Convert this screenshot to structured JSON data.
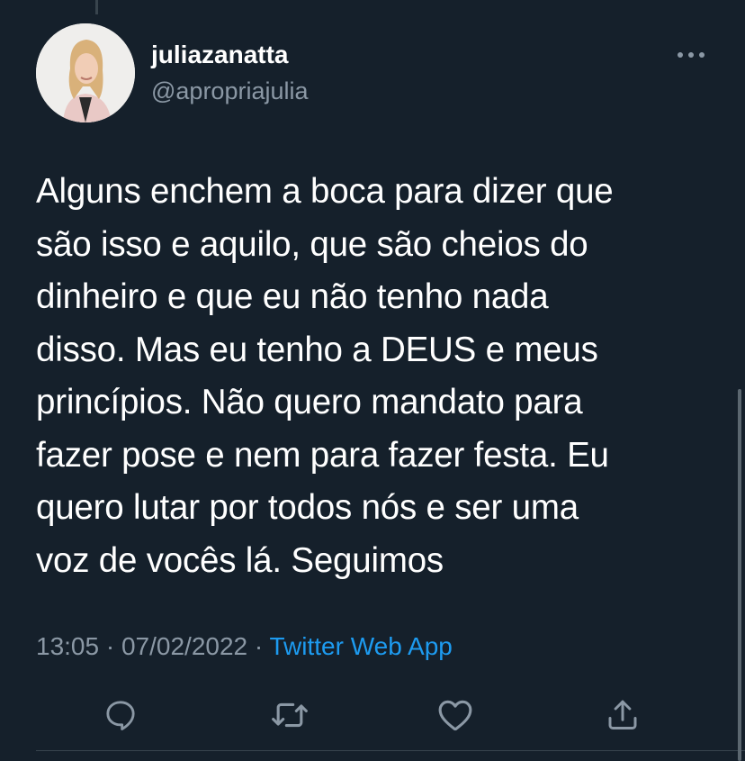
{
  "author": {
    "display_name": "juliazanatta",
    "handle": "@apropriajulia"
  },
  "tweet": {
    "text": "Alguns enchem a boca para dizer que\nsão isso e aquilo, que são cheios do\ndinheiro e que eu não tenho nada\ndisso. Mas eu tenho a DEUS e meus\nprincípios. Não quero mandato para\nfazer pose e nem para fazer festa. Eu\nquero lutar por todos nós e ser uma\nvoz de vocês lá. Seguimos",
    "time": "13:05",
    "date": "07/02/2022",
    "separator": "·",
    "source": "Twitter Web App"
  },
  "actions": {
    "reply": "reply-icon",
    "retweet": "retweet-icon",
    "like": "heart-icon",
    "share": "share-icon"
  },
  "colors": {
    "background": "#15202b",
    "secondary_text": "#8b98a5",
    "link": "#1d9bf0"
  }
}
